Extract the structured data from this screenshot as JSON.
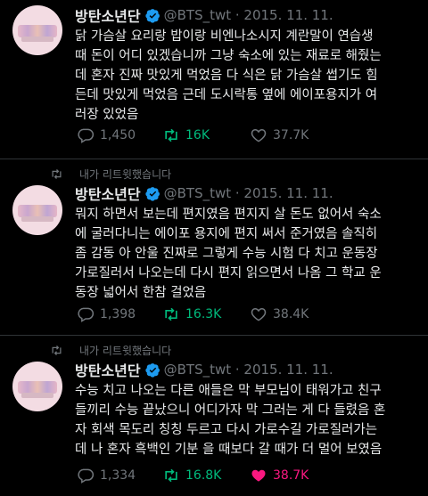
{
  "colors": {
    "background": "#000000",
    "retweet": "#00ba7c",
    "like": "#f91880",
    "verified": "#1d9bf0",
    "muted": "#71767b"
  },
  "tweets": [
    {
      "name": "방탄소년단",
      "handle": "@BTS_twt · 2015. 11. 11.",
      "lines": [
        "닭 가슴살 요리랑 밥이랑 비엔나소시지 계란말이 연습생",
        "때 돈이 어디 있겠습니까 그냥 숙소에 있는 재료로 해줬는",
        "데 혼자 진짜 맛있게 먹었음 다 식은 닭 가슴살 썹기도 힘",
        "든데 맛있게 먹었음 근데 도시락통 옆에 에이포용지가 여",
        "러장 있었음"
      ],
      "replies": "1,450",
      "retweets": "16K",
      "likes": "37.7K",
      "liked": false
    },
    {
      "retweeted_by": "내가 리트윗했습니다",
      "name": "방탄소년단",
      "handle": "@BTS_twt · 2015. 11. 11.",
      "lines": [
        "뭐지 하면서 보는데 편지였음 편지지 살 돈도 없어서 숙소",
        "에 굴러다니는 에이포 용지에 편지 써서 준거였음 솔직히",
        "좀 감동 아 안울 진짜로 그렇게 수능 시험 다 치고 운동장",
        "가로질러서 나오는데 다시 편지 읽으면서 나옴 그 학교 운",
        "동장 넓어서 한참 걸었음"
      ],
      "replies": "1,398",
      "retweets": "16.3K",
      "likes": "38.4K",
      "liked": false
    },
    {
      "retweeted_by": "내가 리트윗했습니다",
      "name": "방탄소년단",
      "handle": "@BTS_twt · 2015. 11. 11.",
      "lines": [
        "수능 치고 나오는 다른 애들은 막 부모님이 태워가고 친구",
        "들끼리 수능 끝났으니 어디가자 막 그러는 게 다 들렸음 혼",
        "자 회색 목도리 칭칭 두르고 다시 가로수길 가로질러가는",
        "데 나 혼자 흑백인 기분 을 때보다 갈 때가 더 멀어 보였음"
      ],
      "replies": "1,334",
      "retweets": "16.8K",
      "likes": "38.7K",
      "liked": true
    }
  ]
}
